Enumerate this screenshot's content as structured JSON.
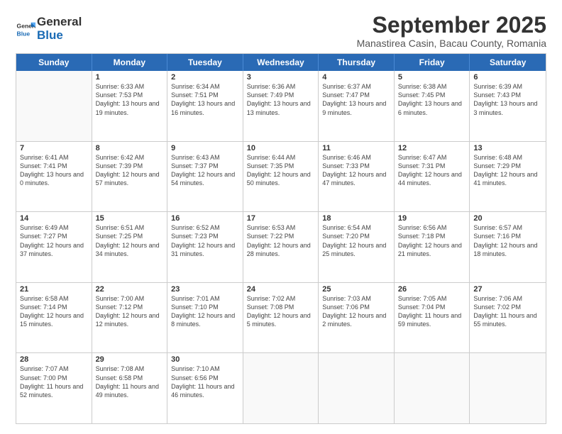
{
  "logo": {
    "general": "General",
    "blue": "Blue"
  },
  "header": {
    "month": "September 2025",
    "location": "Manastirea Casin, Bacau County, Romania"
  },
  "weekdays": [
    "Sunday",
    "Monday",
    "Tuesday",
    "Wednesday",
    "Thursday",
    "Friday",
    "Saturday"
  ],
  "weeks": [
    [
      {
        "day": "",
        "info": ""
      },
      {
        "day": "1",
        "sunrise": "Sunrise: 6:33 AM",
        "sunset": "Sunset: 7:53 PM",
        "daylight": "Daylight: 13 hours and 19 minutes."
      },
      {
        "day": "2",
        "sunrise": "Sunrise: 6:34 AM",
        "sunset": "Sunset: 7:51 PM",
        "daylight": "Daylight: 13 hours and 16 minutes."
      },
      {
        "day": "3",
        "sunrise": "Sunrise: 6:36 AM",
        "sunset": "Sunset: 7:49 PM",
        "daylight": "Daylight: 13 hours and 13 minutes."
      },
      {
        "day": "4",
        "sunrise": "Sunrise: 6:37 AM",
        "sunset": "Sunset: 7:47 PM",
        "daylight": "Daylight: 13 hours and 9 minutes."
      },
      {
        "day": "5",
        "sunrise": "Sunrise: 6:38 AM",
        "sunset": "Sunset: 7:45 PM",
        "daylight": "Daylight: 13 hours and 6 minutes."
      },
      {
        "day": "6",
        "sunrise": "Sunrise: 6:39 AM",
        "sunset": "Sunset: 7:43 PM",
        "daylight": "Daylight: 13 hours and 3 minutes."
      }
    ],
    [
      {
        "day": "7",
        "sunrise": "Sunrise: 6:41 AM",
        "sunset": "Sunset: 7:41 PM",
        "daylight": "Daylight: 13 hours and 0 minutes."
      },
      {
        "day": "8",
        "sunrise": "Sunrise: 6:42 AM",
        "sunset": "Sunset: 7:39 PM",
        "daylight": "Daylight: 12 hours and 57 minutes."
      },
      {
        "day": "9",
        "sunrise": "Sunrise: 6:43 AM",
        "sunset": "Sunset: 7:37 PM",
        "daylight": "Daylight: 12 hours and 54 minutes."
      },
      {
        "day": "10",
        "sunrise": "Sunrise: 6:44 AM",
        "sunset": "Sunset: 7:35 PM",
        "daylight": "Daylight: 12 hours and 50 minutes."
      },
      {
        "day": "11",
        "sunrise": "Sunrise: 6:46 AM",
        "sunset": "Sunset: 7:33 PM",
        "daylight": "Daylight: 12 hours and 47 minutes."
      },
      {
        "day": "12",
        "sunrise": "Sunrise: 6:47 AM",
        "sunset": "Sunset: 7:31 PM",
        "daylight": "Daylight: 12 hours and 44 minutes."
      },
      {
        "day": "13",
        "sunrise": "Sunrise: 6:48 AM",
        "sunset": "Sunset: 7:29 PM",
        "daylight": "Daylight: 12 hours and 41 minutes."
      }
    ],
    [
      {
        "day": "14",
        "sunrise": "Sunrise: 6:49 AM",
        "sunset": "Sunset: 7:27 PM",
        "daylight": "Daylight: 12 hours and 37 minutes."
      },
      {
        "day": "15",
        "sunrise": "Sunrise: 6:51 AM",
        "sunset": "Sunset: 7:25 PM",
        "daylight": "Daylight: 12 hours and 34 minutes."
      },
      {
        "day": "16",
        "sunrise": "Sunrise: 6:52 AM",
        "sunset": "Sunset: 7:23 PM",
        "daylight": "Daylight: 12 hours and 31 minutes."
      },
      {
        "day": "17",
        "sunrise": "Sunrise: 6:53 AM",
        "sunset": "Sunset: 7:22 PM",
        "daylight": "Daylight: 12 hours and 28 minutes."
      },
      {
        "day": "18",
        "sunrise": "Sunrise: 6:54 AM",
        "sunset": "Sunset: 7:20 PM",
        "daylight": "Daylight: 12 hours and 25 minutes."
      },
      {
        "day": "19",
        "sunrise": "Sunrise: 6:56 AM",
        "sunset": "Sunset: 7:18 PM",
        "daylight": "Daylight: 12 hours and 21 minutes."
      },
      {
        "day": "20",
        "sunrise": "Sunrise: 6:57 AM",
        "sunset": "Sunset: 7:16 PM",
        "daylight": "Daylight: 12 hours and 18 minutes."
      }
    ],
    [
      {
        "day": "21",
        "sunrise": "Sunrise: 6:58 AM",
        "sunset": "Sunset: 7:14 PM",
        "daylight": "Daylight: 12 hours and 15 minutes."
      },
      {
        "day": "22",
        "sunrise": "Sunrise: 7:00 AM",
        "sunset": "Sunset: 7:12 PM",
        "daylight": "Daylight: 12 hours and 12 minutes."
      },
      {
        "day": "23",
        "sunrise": "Sunrise: 7:01 AM",
        "sunset": "Sunset: 7:10 PM",
        "daylight": "Daylight: 12 hours and 8 minutes."
      },
      {
        "day": "24",
        "sunrise": "Sunrise: 7:02 AM",
        "sunset": "Sunset: 7:08 PM",
        "daylight": "Daylight: 12 hours and 5 minutes."
      },
      {
        "day": "25",
        "sunrise": "Sunrise: 7:03 AM",
        "sunset": "Sunset: 7:06 PM",
        "daylight": "Daylight: 12 hours and 2 minutes."
      },
      {
        "day": "26",
        "sunrise": "Sunrise: 7:05 AM",
        "sunset": "Sunset: 7:04 PM",
        "daylight": "Daylight: 11 hours and 59 minutes."
      },
      {
        "day": "27",
        "sunrise": "Sunrise: 7:06 AM",
        "sunset": "Sunset: 7:02 PM",
        "daylight": "Daylight: 11 hours and 55 minutes."
      }
    ],
    [
      {
        "day": "28",
        "sunrise": "Sunrise: 7:07 AM",
        "sunset": "Sunset: 7:00 PM",
        "daylight": "Daylight: 11 hours and 52 minutes."
      },
      {
        "day": "29",
        "sunrise": "Sunrise: 7:08 AM",
        "sunset": "Sunset: 6:58 PM",
        "daylight": "Daylight: 11 hours and 49 minutes."
      },
      {
        "day": "30",
        "sunrise": "Sunrise: 7:10 AM",
        "sunset": "Sunset: 6:56 PM",
        "daylight": "Daylight: 11 hours and 46 minutes."
      },
      {
        "day": "",
        "info": ""
      },
      {
        "day": "",
        "info": ""
      },
      {
        "day": "",
        "info": ""
      },
      {
        "day": "",
        "info": ""
      }
    ]
  ]
}
